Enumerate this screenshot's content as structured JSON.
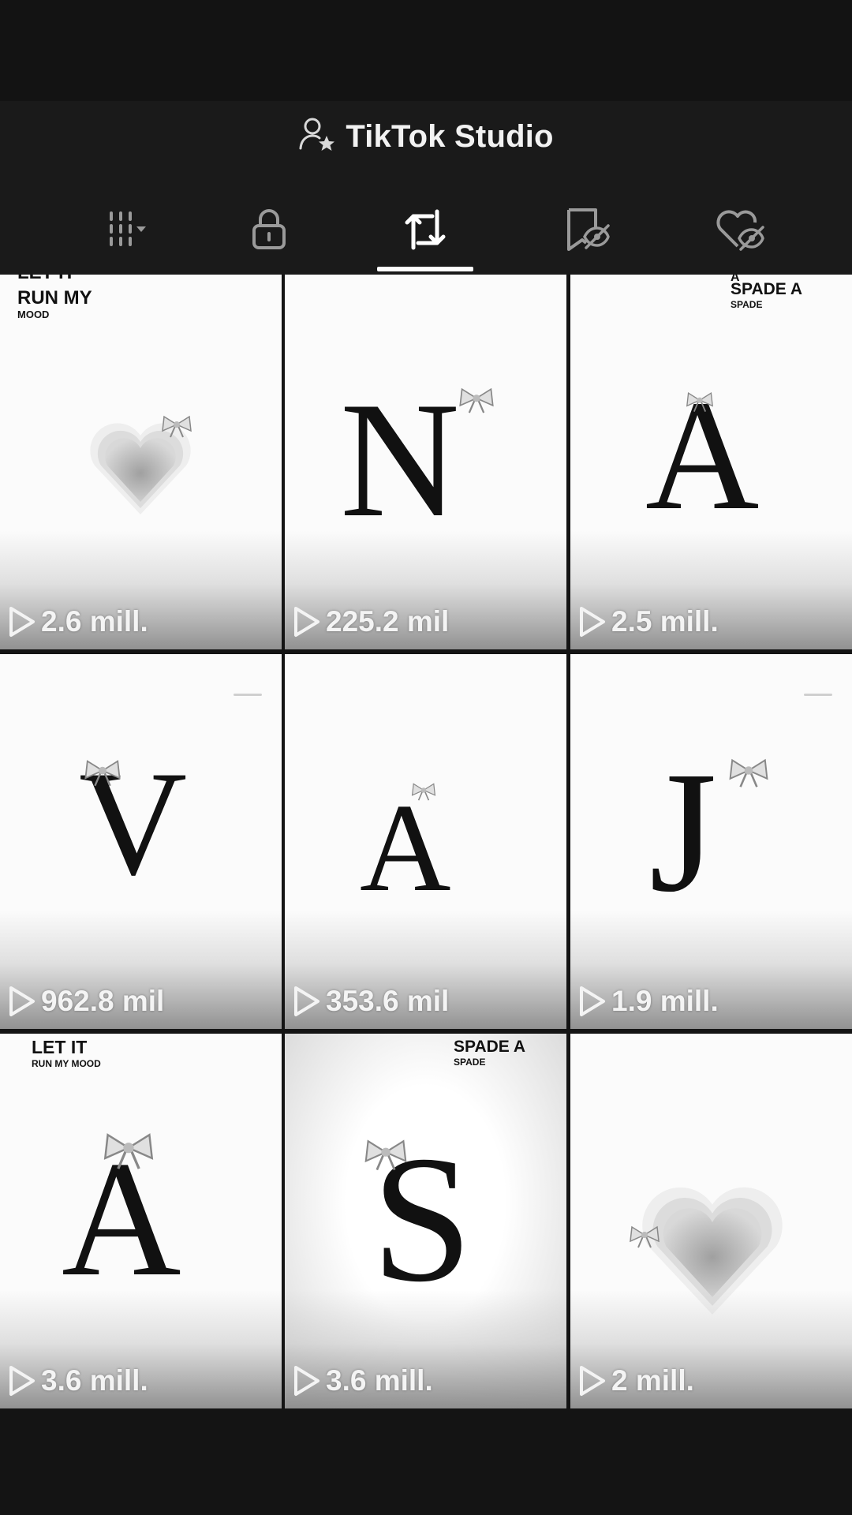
{
  "header": {
    "title": "TikTok Studio",
    "icon": "person-star-icon"
  },
  "tabs": [
    {
      "name": "grid-filter",
      "icon": "bars-dropdown-icon"
    },
    {
      "name": "private",
      "icon": "lock-icon"
    },
    {
      "name": "reposts",
      "icon": "repost-icon",
      "active": true
    },
    {
      "name": "favorites",
      "icon": "bookmark-hidden-icon"
    },
    {
      "name": "liked",
      "icon": "heart-hidden-icon"
    }
  ],
  "videos": [
    {
      "views": "2.6 mill.",
      "caption_top": "LET IT",
      "caption_main": "RUN MY",
      "caption_sub": "MOOD",
      "content": "heart-emoji-with-bow"
    },
    {
      "views": "225.2 mil",
      "letter": "N"
    },
    {
      "views": "2.5 mill.",
      "caption_top": "A",
      "caption_main": "SPADE A",
      "caption_sub": "SPADE",
      "letter": "A"
    },
    {
      "views": "962.8 mil",
      "letter": "V"
    },
    {
      "views": "353.6 mil",
      "letter": "A"
    },
    {
      "views": "1.9 mill.",
      "letter": "J"
    },
    {
      "views": "3.6 mill.",
      "caption_main": "LET IT",
      "caption_sub": "RUN MY MOOD",
      "letter": "A"
    },
    {
      "views": "3.6 mill.",
      "caption_main": "SPADE A",
      "caption_sub": "SPADE",
      "letter": "S"
    },
    {
      "views": "2 mill.",
      "content": "heart-emoji-with-bow"
    }
  ]
}
